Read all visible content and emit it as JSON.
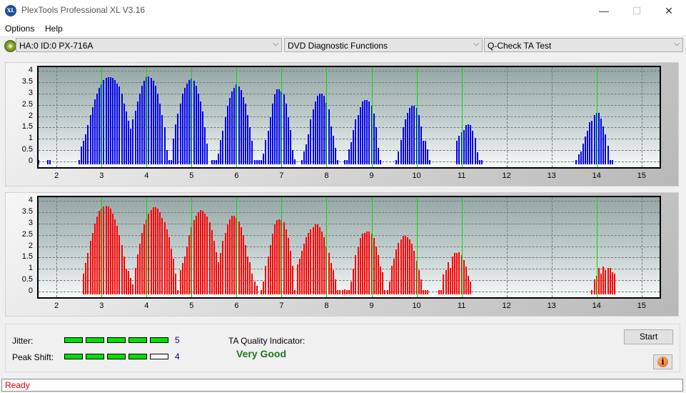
{
  "window": {
    "title": "PlexTools Professional XL V3.16",
    "app_icon_text": "XL",
    "minimize_glyph": "—",
    "maximize_glyph": "☐",
    "close_glyph": "✕"
  },
  "menu": [
    "Options",
    "Help"
  ],
  "toolbar": {
    "drive": "HA:0 ID:0  PX-716A",
    "function": "DVD Diagnostic Functions",
    "test": "Q-Check TA Test",
    "chevron": "⌵"
  },
  "results": {
    "jitter_label": "Jitter:",
    "jitter_value": "5",
    "jitter_level": 5,
    "peak_shift_label": "Peak Shift:",
    "peak_shift_value": "4",
    "peak_shift_level": 4,
    "meter_max": 5,
    "ta_label": "TA Quality Indicator:",
    "ta_value": "Very Good",
    "start_label": "Start",
    "info_glyph": "i"
  },
  "status": "Ready",
  "colors": {
    "upper_bars": "#0000ee",
    "lower_bars": "#ff0000",
    "reference_lines": "#00e000",
    "meter_on": "#00e000",
    "quality_text": "#1a7a1a",
    "status_text": "#e00000",
    "meter_value_text": "#00008b"
  },
  "chart_data": [
    {
      "name": "upper-ta-histogram",
      "type": "bar",
      "xlim": [
        1.6,
        15.4
      ],
      "ylim": [
        0,
        4.1
      ],
      "xticks": [
        "2",
        "3",
        "4",
        "5",
        "6",
        "7",
        "8",
        "9",
        "10",
        "11",
        "12",
        "13",
        "14",
        "15"
      ],
      "yticks": [
        "0",
        "0.5",
        "1",
        "1.5",
        "2",
        "2.5",
        "3",
        "3.5",
        "4"
      ],
      "reference_lines_x": [
        3,
        4,
        5,
        6,
        7,
        8,
        9,
        10,
        11,
        14
      ],
      "grid": true,
      "bar_step": 0.05,
      "series": [
        {
          "start": 1.6,
          "values": [
            0.05,
            0,
            0,
            0,
            0.05,
            0.05
          ]
        },
        {
          "start": 2.5,
          "values": [
            0.05,
            0.65,
            0.92,
            1.2,
            1.6,
            2.05,
            2.4,
            2.75,
            3.0,
            3.25,
            3.42,
            3.6,
            3.7,
            3.72,
            3.72,
            3.7,
            3.6,
            3.45,
            3.3,
            3.0,
            2.55,
            2.2,
            1.8,
            1.45,
            1.85,
            2.25,
            2.65,
            3.0,
            3.35,
            3.55,
            3.72,
            3.75,
            3.7,
            3.55,
            3.35,
            3.0,
            2.55,
            2.05,
            1.5,
            0.5,
            0.05
          ]
        },
        {
          "start": 4.5,
          "values": [
            0.05,
            0.05,
            1.0,
            1.65,
            2.1,
            2.55,
            3.0,
            3.25,
            3.45,
            3.6,
            3.65,
            3.55,
            3.35,
            3.0,
            2.65,
            2.2,
            1.5,
            0.8,
            0,
            0.05
          ]
        },
        {
          "start": 5.5,
          "values": [
            0.05,
            0.05,
            0.35,
            0.95,
            1.35,
            1.95,
            2.45,
            2.8,
            3.1,
            3.25,
            3.4,
            3.3,
            3.15,
            2.85,
            2.55,
            2.05,
            1.5,
            0.9,
            0.05,
            0.05
          ]
        },
        {
          "start": 6.5,
          "values": [
            0.05,
            0.05,
            0.35,
            0.95,
            1.35,
            1.95,
            2.55,
            2.95,
            3.2,
            3.2,
            3.1,
            2.95,
            2.55,
            1.95,
            1.4,
            0.5,
            0.1
          ]
        },
        {
          "start": 7.45,
          "values": [
            0.05,
            0.45,
            0.75,
            1.2,
            1.85,
            2.3,
            2.65,
            2.9,
            3.0,
            3.0,
            2.9,
            2.6,
            2.3,
            1.55,
            1.15,
            0.6,
            0.05
          ]
        },
        {
          "start": 8.4,
          "values": [
            0.05,
            0.05,
            0.55,
            0.85,
            1.4,
            1.85,
            2.05,
            2.4,
            2.65,
            2.7,
            2.7,
            2.65,
            2.45,
            2.1,
            1.5,
            0.6,
            0.05
          ]
        },
        {
          "start": 9.55,
          "values": [
            0.05,
            0.45,
            0.95,
            1.5,
            1.85,
            2.15,
            2.35,
            2.45,
            2.45,
            2.35,
            2.05,
            1.55,
            0.9,
            0.9,
            0.55,
            0.05
          ]
        },
        {
          "start": 10.9,
          "values": [
            0.9,
            1.15,
            1.3,
            1.4,
            1.6,
            1.65,
            1.6,
            1.35,
            1.05,
            0.4,
            0.05,
            0.05
          ]
        },
        {
          "start": 13.55,
          "values": [
            0.05,
            0.3,
            0.45,
            0.8,
            1.1,
            1.35,
            1.75,
            1.8,
            2.05,
            2.15,
            2.15,
            1.9,
            1.55,
            1.2,
            0.7,
            0.05,
            0.05
          ]
        }
      ]
    },
    {
      "name": "lower-ta-histogram",
      "type": "bar",
      "xlim": [
        1.6,
        15.4
      ],
      "ylim": [
        0,
        4.1
      ],
      "xticks": [
        "2",
        "3",
        "4",
        "5",
        "6",
        "7",
        "8",
        "9",
        "10",
        "11",
        "12",
        "13",
        "14",
        "15"
      ],
      "yticks": [
        "0",
        "0.5",
        "1",
        "1.5",
        "2",
        "2.5",
        "3",
        "3.5",
        "4"
      ],
      "reference_lines_x": [
        3,
        4,
        5,
        6,
        7,
        8,
        9,
        10,
        11,
        14
      ],
      "grid": true,
      "bar_step": 0.05,
      "series": [
        {
          "start": 2.6,
          "values": [
            0.8,
            1.25,
            1.7,
            2.25,
            2.6,
            3.0,
            3.3,
            3.55,
            3.65,
            3.75,
            3.78,
            3.75,
            3.65,
            3.45,
            3.2,
            2.9,
            2.5,
            2.05,
            1.55,
            1.0,
            0.9,
            0.6,
            0.3,
            1.05,
            1.65,
            2.1,
            2.6,
            2.95,
            3.2,
            3.45,
            3.6,
            3.72,
            3.72,
            3.65,
            3.5,
            3.25,
            3.05,
            2.75,
            2.4,
            1.9,
            1.45,
            0.8,
            0.05,
            0.95,
            1.25,
            1.55,
            2.0,
            2.5,
            2.85,
            3.15,
            3.35,
            3.5,
            3.58,
            3.55,
            3.45,
            3.3,
            3.05,
            2.7,
            2.25,
            1.75,
            1.3,
            0.9
          ]
        },
        {
          "start": 5.55,
          "values": [
            0.65,
            1.15,
            1.7,
            2.25,
            2.6,
            2.95,
            3.2,
            3.35,
            3.35,
            3.25,
            3.1,
            2.85,
            2.5,
            2.05,
            1.55,
            1.3,
            0.8,
            0.45,
            0.25,
            0,
            0.05,
            0.45,
            1.15,
            1.55,
            2.05,
            2.55,
            2.95,
            3.15,
            3.2,
            3.15,
            3.05,
            2.75,
            2.35,
            1.8,
            1.15,
            0.05,
            0.05,
            0.05
          ]
        },
        {
          "start": 7.35,
          "values": [
            1.2,
            1.45,
            1.8,
            2.1,
            2.4,
            2.6,
            2.75,
            2.85,
            2.95,
            2.95,
            2.85,
            2.65,
            2.4,
            2.0,
            1.7,
            1.25,
            0.95,
            0.55,
            0.05,
            0.05,
            0.05,
            0.1,
            0.05,
            0.05
          ]
        },
        {
          "start": 8.55,
          "values": [
            0.45,
            1.0,
            1.6,
            1.95,
            2.35,
            2.55,
            2.6,
            2.65,
            2.65,
            2.55,
            2.35,
            2.0,
            1.6,
            1.1,
            0.85,
            0.05,
            0.05,
            0.05
          ]
        },
        {
          "start": 9.4,
          "values": [
            0.45,
            1.15,
            1.45,
            1.85,
            2.15,
            2.3,
            2.45,
            2.45,
            2.4,
            2.3,
            2.1,
            1.8,
            1.35,
            0.95,
            0.55,
            0.05,
            0.05,
            0.05
          ]
        },
        {
          "start": 10.5,
          "values": [
            0.05,
            0.05,
            0.75,
            0.95,
            1.3,
            1.05,
            1.55,
            1.7,
            1.7,
            1.75,
            1.6,
            1.4,
            1.1,
            0.7,
            0.45
          ]
        },
        {
          "start": 13.9,
          "values": [
            0.05,
            0.55,
            0.7,
            1.05,
            0.8,
            1.1,
            0.95,
            1.05,
            1.05,
            0.85,
            0.8
          ]
        }
      ]
    }
  ]
}
